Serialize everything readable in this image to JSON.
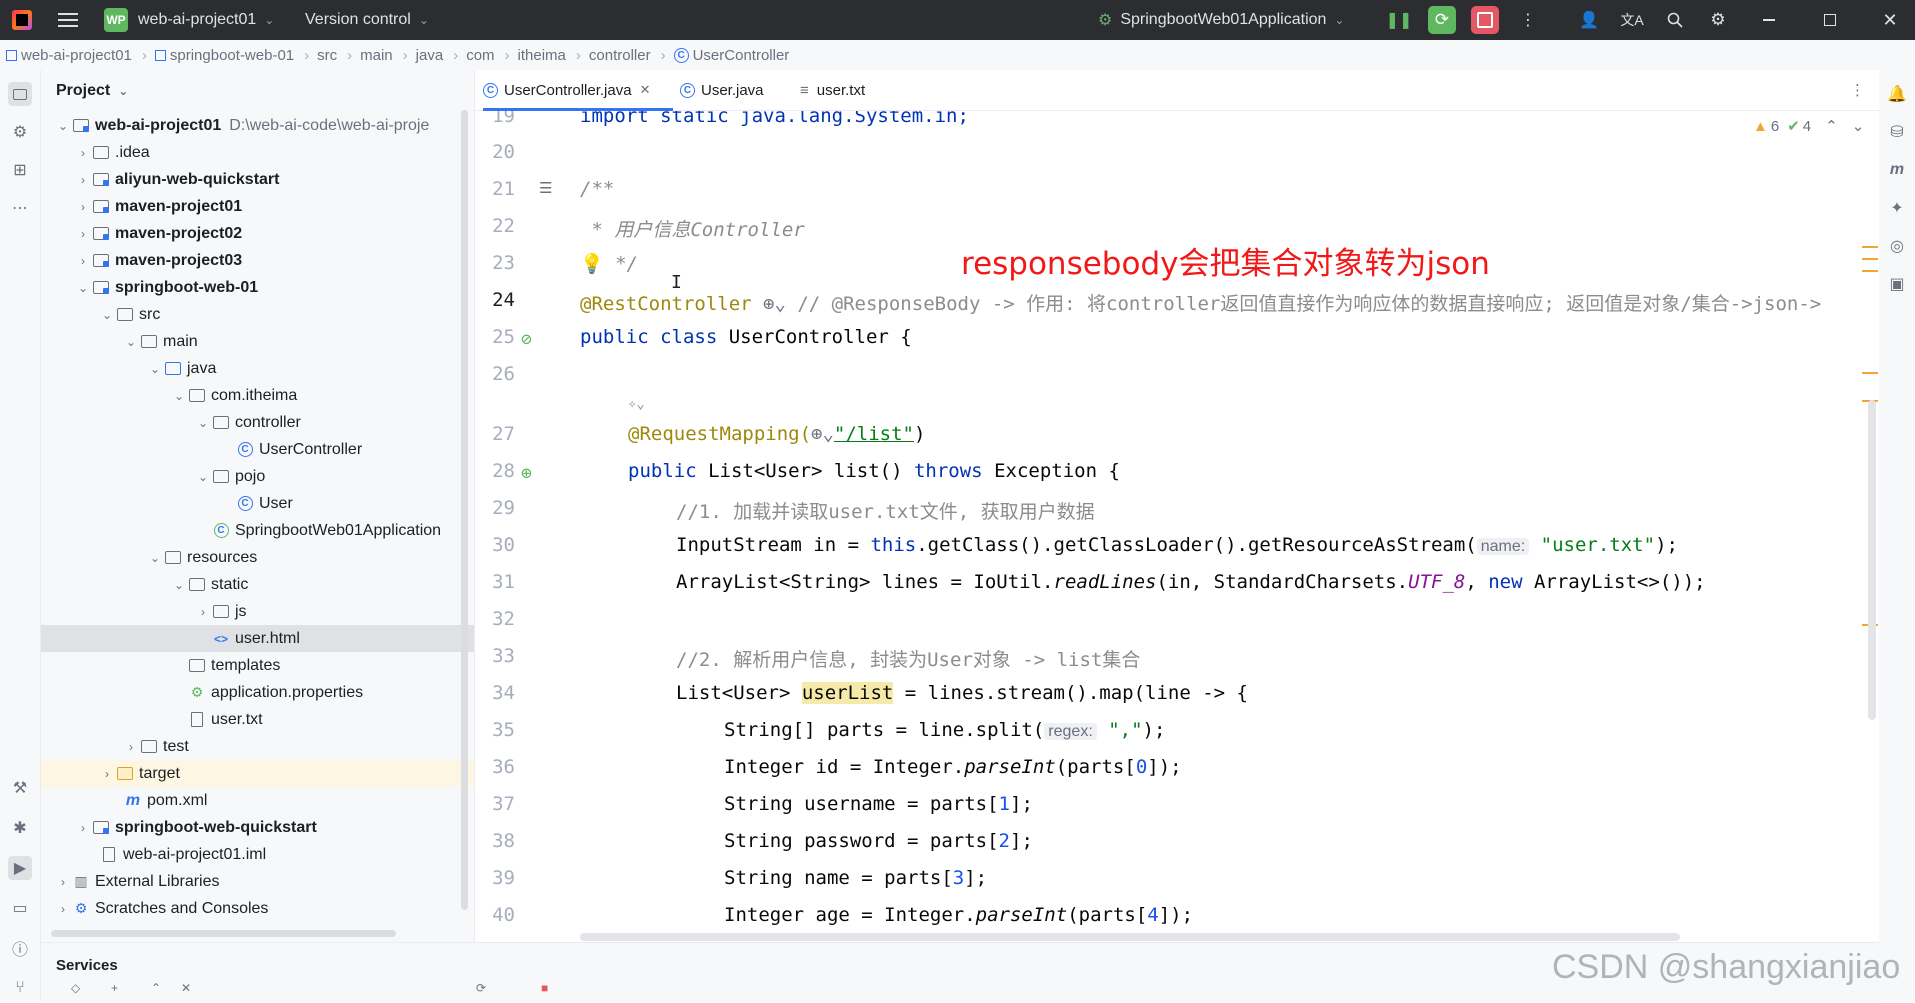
{
  "titlebar": {
    "project_badge": "WP",
    "project_name": "web-ai-project01",
    "vcs": "Version control",
    "run_config": "SpringbootWeb01Application"
  },
  "breadcrumb": [
    "web-ai-project01",
    "springboot-web-01",
    "src",
    "main",
    "java",
    "com",
    "itheima",
    "controller",
    "UserController"
  ],
  "project_panel": {
    "title": "Project",
    "root_name": "web-ai-project01",
    "root_path": "D:\\web-ai-code\\web-ai-proje",
    "items": [
      {
        "label": ".idea"
      },
      {
        "label": "aliyun-web-quickstart"
      },
      {
        "label": "maven-project01"
      },
      {
        "label": "maven-project02"
      },
      {
        "label": "maven-project03"
      },
      {
        "label": "springboot-web-01"
      },
      {
        "label": "src"
      },
      {
        "label": "main"
      },
      {
        "label": "java"
      },
      {
        "label": "com.itheima"
      },
      {
        "label": "controller"
      },
      {
        "label": "UserController"
      },
      {
        "label": "pojo"
      },
      {
        "label": "User"
      },
      {
        "label": "SpringbootWeb01Application"
      },
      {
        "label": "resources"
      },
      {
        "label": "static"
      },
      {
        "label": "js"
      },
      {
        "label": "user.html"
      },
      {
        "label": "templates"
      },
      {
        "label": "application.properties"
      },
      {
        "label": "user.txt"
      },
      {
        "label": "test"
      },
      {
        "label": "target"
      },
      {
        "label": "pom.xml"
      },
      {
        "label": "springboot-web-quickstart"
      },
      {
        "label": "web-ai-project01.iml"
      },
      {
        "label": "External Libraries"
      },
      {
        "label": "Scratches and Consoles"
      }
    ]
  },
  "tabs": [
    {
      "label": "UserController.java"
    },
    {
      "label": "User.java"
    },
    {
      "label": "user.txt"
    }
  ],
  "inspections": {
    "warnings": "6",
    "ok": "4"
  },
  "line_numbers": [
    "19",
    "20",
    "21",
    "22",
    "23",
    "24",
    "25",
    "26",
    "27",
    "28",
    "29",
    "30",
    "31",
    "32",
    "33",
    "34",
    "35",
    "36",
    "37",
    "38",
    "39",
    "40"
  ],
  "code": {
    "l19": "import static java.lang.System.in;",
    "l21": "/**",
    "l22": " * 用户信息Controller",
    "l23": " */",
    "l24_ann": "@RestController",
    "l24_comment": "// @ResponseBody -> 作用: 将controller返回值直接作为响应体的数据直接响应; 返回值是对象/集合->json->",
    "l25_kw": "public class",
    "l25_rest": " UserController {",
    "l27_ann": "@RequestMapping(",
    "l27_str": "\"/list\"",
    "l27_end": ")",
    "l28_kw1": "public",
    "l28_mid": " List<User> list() ",
    "l28_kw2": "throws",
    "l28_rest": " Exception {",
    "l29": "//1. 加载并读取user.txt文件, 获取用户数据",
    "l30_a": "InputStream in = ",
    "l30_kw": "this",
    "l30_b": ".getClass().getClassLoader().getResourceAsStream(",
    "l30_hint": "name:",
    "l30_str": "\"user.txt\"",
    "l30_end": ");",
    "l31_a": "ArrayList<String> lines = IoUtil.",
    "l31_m": "readLines",
    "l31_b": "(in, StandardCharsets.",
    "l31_f": "UTF_8",
    "l31_c": ", ",
    "l31_kw": "new",
    "l31_d": " ArrayList<>());",
    "l33": "//2. 解析用户信息, 封装为User对象 -> list集合",
    "l34_a": "List<User> ",
    "l34_v": "userList",
    "l34_b": " = lines.stream().map(line -> {",
    "l35_a": "String[] parts = line.split(",
    "l35_hint": "regex:",
    "l35_str": "\",\"",
    "l35_end": ");",
    "l36_a": "Integer id = Integer.",
    "l36_m": "parseInt",
    "l36_b": "(parts[",
    "l36_n": "0",
    "l36_c": "]);",
    "l37_a": "String username = parts[",
    "l37_n": "1",
    "l37_b": "];",
    "l38_a": "String password = parts[",
    "l38_n": "2",
    "l38_b": "];",
    "l39_a": "String name = parts[",
    "l39_n": "3",
    "l39_b": "];",
    "l40_a": "Integer age = Integer.",
    "l40_m": "parseInt",
    "l40_b": "(parts[",
    "l40_n": "4",
    "l40_c": "]);"
  },
  "overlay_note": "responsebody会把集合对象转为json",
  "services": {
    "title": "Services"
  },
  "watermark": "CSDN @shangxianjiao",
  "colors": {
    "accent": "#3574f0",
    "overlay": "#f21818",
    "titlebar": "#2b2d30"
  }
}
